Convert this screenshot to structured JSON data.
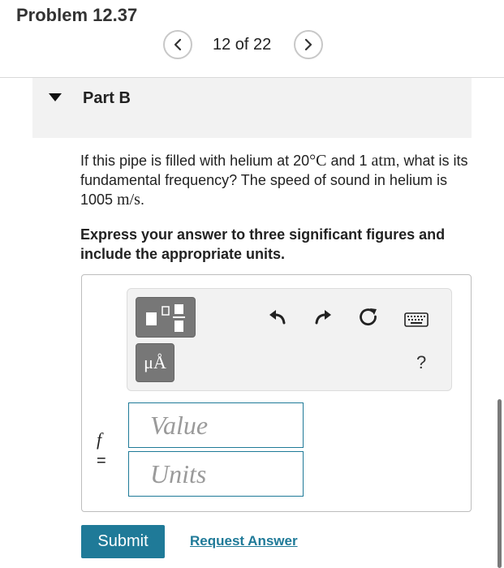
{
  "header": {
    "title": "Problem 12.37",
    "counter": "12 of 22"
  },
  "part": {
    "label": "Part B"
  },
  "question": {
    "text_1": "If this pipe is filled with helium at 20",
    "temp_unit": "°C",
    "text_2": " and 1 ",
    "pressure_unit": "atm",
    "text_3": ", what is its fundamental frequency? The speed of sound in helium is 1005 ",
    "speed_unit": "m/s",
    "text_4": "."
  },
  "instruction": "Express your answer to three significant figures and include the appropriate units.",
  "answer": {
    "units_button": "μÅ",
    "help": "?",
    "variable": "f",
    "equals": "=",
    "value_placeholder": "Value",
    "units_placeholder": "Units"
  },
  "actions": {
    "submit": "Submit",
    "request_answer": "Request Answer"
  },
  "colors": {
    "accent": "#1f7a98",
    "toolbar_button": "#777777",
    "panel": "#f2f2f2"
  },
  "icons": [
    "chevron-left-icon",
    "chevron-right-icon",
    "caret-down-icon",
    "templates-icon",
    "undo-icon",
    "redo-icon",
    "reset-icon",
    "keyboard-icon"
  ]
}
